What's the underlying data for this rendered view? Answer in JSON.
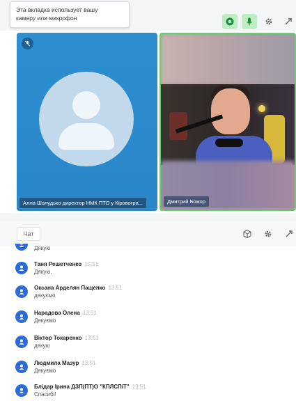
{
  "tooltip": {
    "line1": "Эта вкладка использует вашу",
    "line2": "камеру или микрофон"
  },
  "top_icons": [
    "camera-icon",
    "microphone-icon",
    "gear-icon",
    "expand-icon"
  ],
  "participants": {
    "left_name": "Алла Шолудько директор НМК ПТО у Кіровогра...",
    "right_name": "Дмитрий Божор"
  },
  "chat": {
    "tab_label": "Чат",
    "header_icons": [
      "cube-icon",
      "gear-icon",
      "expand-icon"
    ],
    "messages": [
      {
        "name": "",
        "time": "",
        "text": "Дякую"
      },
      {
        "name": "Таня Решетченко",
        "time": "13:51",
        "text": "Дякую."
      },
      {
        "name": "Оксана Арделян Пащенко",
        "time": "13:51",
        "text": "дякуємо"
      },
      {
        "name": "Нарадова Олена",
        "time": "13:51",
        "text": "Дякуємо"
      },
      {
        "name": "Віктор Токаренко",
        "time": "13:51",
        "text": "дякую"
      },
      {
        "name": "Людмила Мазур",
        "time": "13:51",
        "text": "Дякуємо"
      },
      {
        "name": "Блідар Ірина ДЗП(ПТ)О \"КПЛСПіТ\"",
        "time": "13:51",
        "text": "Спасибі!"
      }
    ]
  },
  "colors": {
    "accent_green": "#5fd36a",
    "tile_blue": "#2d8fd0",
    "avatar_blue": "#2c6bd8"
  }
}
